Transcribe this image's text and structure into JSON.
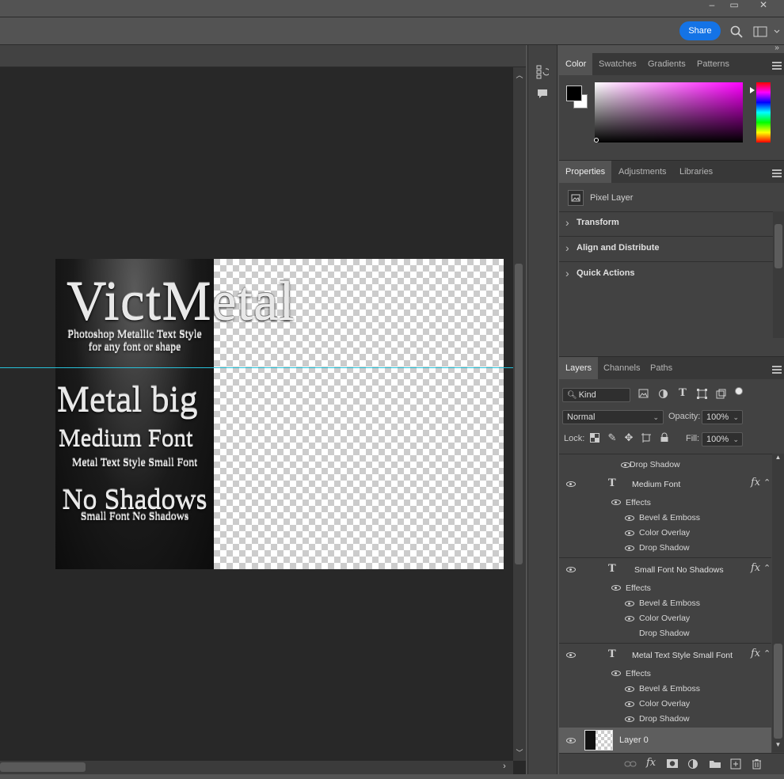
{
  "window": {
    "minimize": "–",
    "maximize": "▭",
    "close": "✕"
  },
  "options_bar": {
    "share_label": "Share",
    "search_icon": "search-icon",
    "workspace_icon": "workspace-icon"
  },
  "canvas": {
    "title": "VictMetal",
    "subtitle_line1": "Photoshop Metallic Text Style",
    "subtitle_line2": "for any font or shape",
    "text_big": "Metal big",
    "text_medium": "Medium Font",
    "text_small": "Metal Text Style Small Font",
    "text_noshadow": "No Shadows",
    "text_noshadow_small": "Small Font No Shadows"
  },
  "color_panel": {
    "tabs": [
      "Color",
      "Swatches",
      "Gradients",
      "Patterns"
    ],
    "active_tab": "Color",
    "foreground": "#000000",
    "background": "#ffffff",
    "hue_color": "#ff00ff"
  },
  "properties_panel": {
    "tabs": [
      "Properties",
      "Adjustments",
      "Libraries"
    ],
    "layer_type": "Pixel Layer",
    "sections": [
      "Transform",
      "Align and Distribute",
      "Quick Actions"
    ]
  },
  "layers_panel": {
    "tabs": [
      "Layers",
      "Channels",
      "Paths"
    ],
    "filter_kind": "Kind",
    "blend_mode": "Normal",
    "opacity_label": "Opacity:",
    "opacity_value": "100%",
    "lock_label": "Lock:",
    "fill_label": "Fill:",
    "fill_value": "100%",
    "partial_effect": "Drop Shadow",
    "layers": [
      {
        "name": "Medium Font",
        "effects_label": "Effects",
        "effects": [
          "Bevel & Emboss",
          "Color Overlay",
          "Drop Shadow"
        ],
        "effect_visible": [
          true,
          true,
          true
        ]
      },
      {
        "name": "Small Font No Shadows",
        "effects_label": "Effects",
        "effects": [
          "Bevel & Emboss",
          "Color Overlay",
          "Drop Shadow"
        ],
        "effect_visible": [
          true,
          true,
          false
        ]
      },
      {
        "name": "Metal Text Style Small Font",
        "effects_label": "Effects",
        "effects": [
          "Bevel & Emboss",
          "Color Overlay",
          "Drop Shadow"
        ],
        "effect_visible": [
          true,
          true,
          true
        ]
      }
    ],
    "base_layer": "Layer 0",
    "fx_label": "fx"
  },
  "accent_color": "#1473e6",
  "guide_color": "#27c0d8"
}
